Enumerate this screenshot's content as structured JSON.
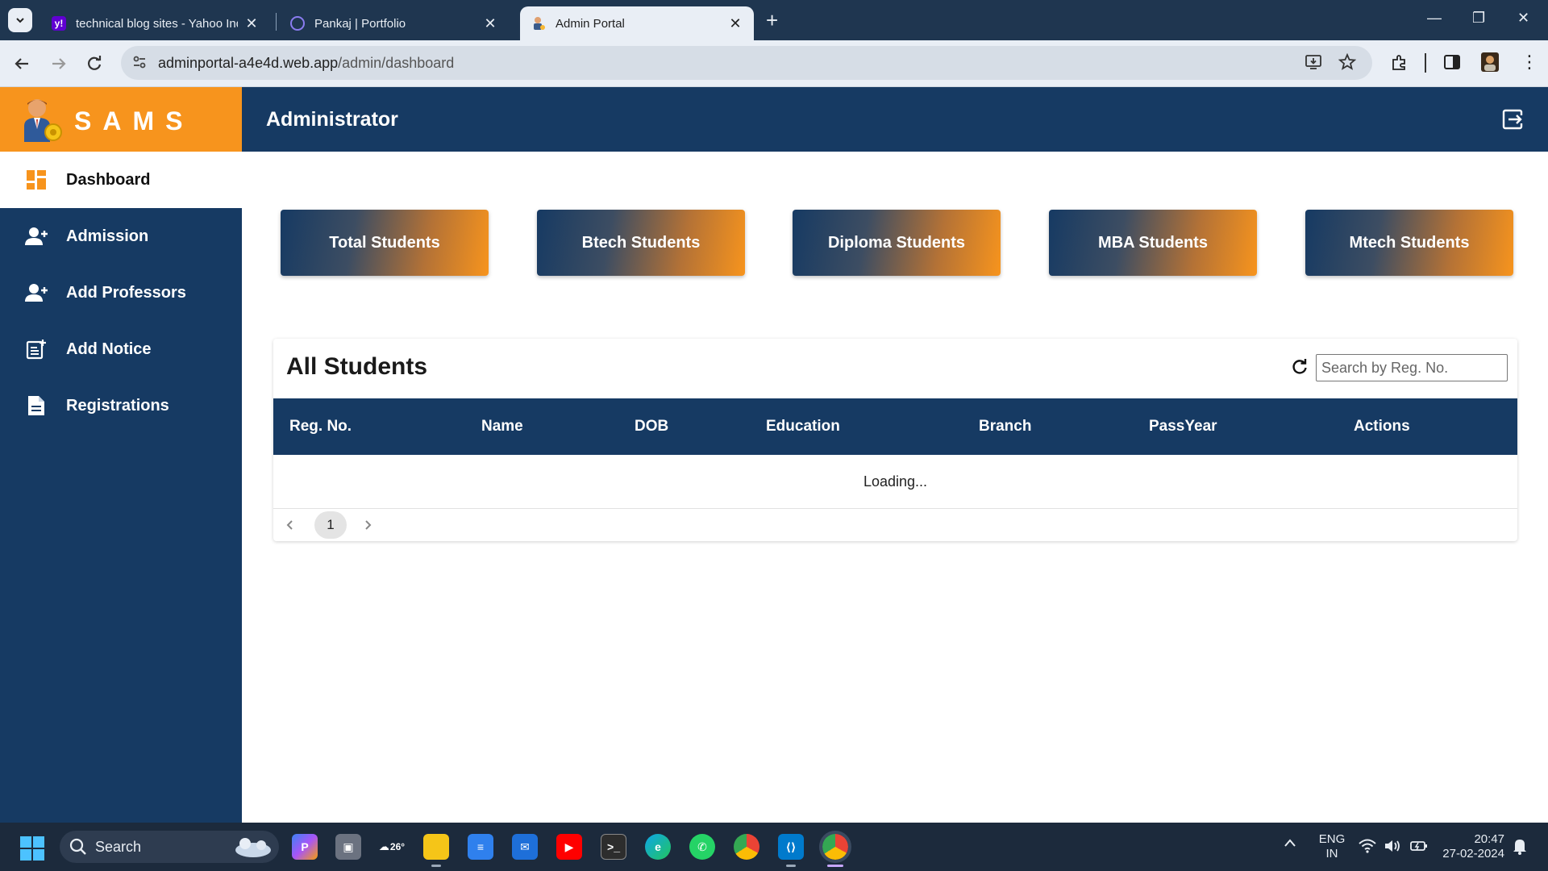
{
  "browser": {
    "tabs": [
      {
        "title": "technical blog sites - Yahoo Ind",
        "favicon": "yahoo-icon",
        "active": false
      },
      {
        "title": "Pankaj | Portfolio",
        "favicon": "portfolio-icon",
        "active": false
      },
      {
        "title": "Admin Portal",
        "favicon": "admin-icon",
        "active": true
      }
    ],
    "new_tab": "+",
    "url_host": "adminportal-a4e4d.web.app",
    "url_path": "/admin/dashboard"
  },
  "app": {
    "brand": "SAMS",
    "header_title": "Administrator",
    "nav": [
      {
        "label": "Dashboard",
        "icon": "dashboard-icon",
        "active": true
      },
      {
        "label": "Admission",
        "icon": "add-user-icon",
        "active": false
      },
      {
        "label": "Add Professors",
        "icon": "add-person-icon",
        "active": false
      },
      {
        "label": "Add Notice",
        "icon": "add-notice-icon",
        "active": false
      },
      {
        "label": "Registrations",
        "icon": "document-icon",
        "active": false
      }
    ],
    "stat_cards": [
      "Total Students",
      "Btech Students",
      "Diploma Students",
      "MBA Students",
      "Mtech Students"
    ],
    "students_table": {
      "title": "All Students",
      "search_placeholder": "Search by Reg. No.",
      "columns": [
        "Reg. No.",
        "Name",
        "DOB",
        "Education",
        "Branch",
        "PassYear",
        "Actions"
      ],
      "status": "Loading...",
      "current_page": "1"
    },
    "colors": {
      "primary": "#163a63",
      "accent": "#f7941d"
    }
  },
  "taskbar": {
    "search_label": "Search",
    "weather": "26°",
    "lang_1": "ENG",
    "lang_2": "IN",
    "time": "20:47",
    "date": "27-02-2024"
  }
}
